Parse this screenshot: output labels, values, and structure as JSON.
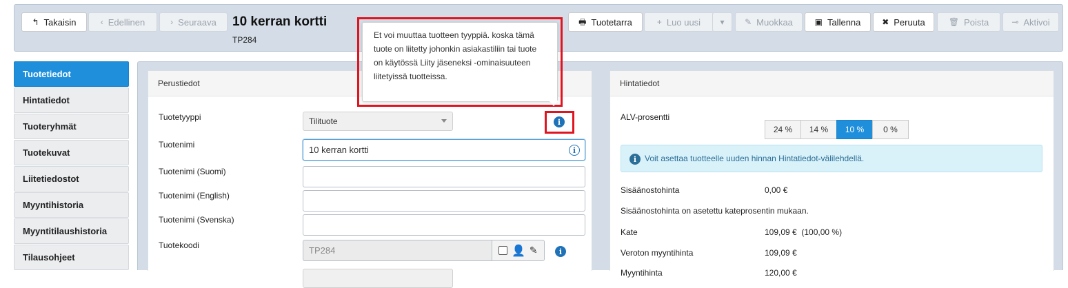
{
  "toolbar": {
    "back": "Takaisin",
    "previous": "Edellinen",
    "next": "Seuraava",
    "product_card": "Tuotetarra",
    "create_new": "Luo uusi",
    "edit": "Muokkaa",
    "save": "Tallenna",
    "cancel": "Peruuta",
    "delete": "Poista",
    "activate": "Aktivoi"
  },
  "header": {
    "title": "10 kerran kortti",
    "code": "TP284"
  },
  "tooltip": {
    "text": "Et voi muuttaa tuotteen tyyppiä. koska tämä tuote on liitetty johonkin asiakastiliin tai tuote on käytössä Liity jäseneksi -ominaisuuteen liitetyissä tuotteissa."
  },
  "sidebar": {
    "items": [
      {
        "label": "Tuotetiedot",
        "active": true
      },
      {
        "label": "Hintatiedot",
        "active": false
      },
      {
        "label": "Tuoteryhmät",
        "active": false
      },
      {
        "label": "Tuotekuvat",
        "active": false
      },
      {
        "label": "Liitetiedostot",
        "active": false
      },
      {
        "label": "Myyntihistoria",
        "active": false
      },
      {
        "label": "Myyntitilaushistoria",
        "active": false
      },
      {
        "label": "Tilausohjeet",
        "active": false
      }
    ]
  },
  "basic": {
    "heading": "Perustiedot",
    "type_label": "Tuotetyyppi",
    "type_value": "Tilituote",
    "name_label": "Tuotenimi",
    "name_value": "10 kerran kortti",
    "name_fi_label": "Tuotenimi (Suomi)",
    "name_fi_value": "",
    "name_en_label": "Tuotenimi (English)",
    "name_en_value": "",
    "name_sv_label": "Tuotenimi (Svenska)",
    "name_sv_value": "",
    "code_label": "Tuotekoodi",
    "code_value": "TP284"
  },
  "pricing": {
    "heading": "Hintatiedot",
    "vat_label": "ALV-prosentti",
    "vat_options": [
      "24 %",
      "14 %",
      "10 %",
      "0 %"
    ],
    "vat_selected": "10 %",
    "alert": "Voit asettaa tuotteelle uuden hinnan Hintatiedot-välilehdellä.",
    "purchase_label": "Sisäänostohinta",
    "purchase_value": "0,00 €",
    "purchase_note": "Sisäänostohinta on asetettu kateprosentin mukaan.",
    "margin_label": "Kate",
    "margin_value": "109,09 €  (100,00 %)",
    "net_label": "Veroton myyntihinta",
    "net_value": "109,09 €",
    "gross_label": "Myyntihinta",
    "gross_value": "120,00 €"
  },
  "colors": {
    "accent": "#1f8fdc",
    "highlight": "#e0141f",
    "info": "#1f72b8"
  }
}
